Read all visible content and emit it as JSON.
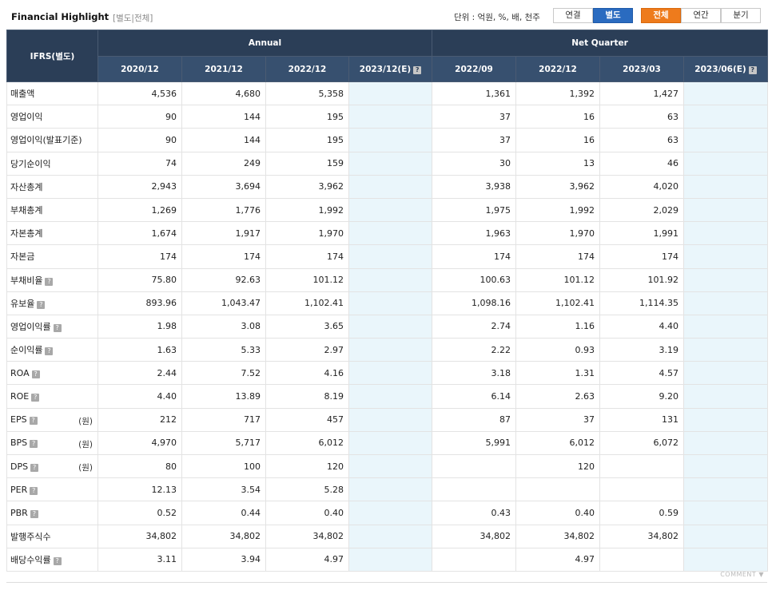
{
  "header": {
    "title": "Financial Highlight",
    "subtitle": "[별도|전체]",
    "unit": "단위 : 억원, %, 배, 천주",
    "buttons": {
      "consolidated": "연결",
      "separate": "별도",
      "all": "전체",
      "annual": "연간",
      "quarter": "분기"
    }
  },
  "table": {
    "corner_label": "IFRS(별도)",
    "groups": [
      "Annual",
      "Net Quarter"
    ],
    "columns": [
      "2020/12",
      "2021/12",
      "2022/12",
      "2023/12(E)",
      "2022/09",
      "2022/12",
      "2023/03",
      "2023/06(E)"
    ],
    "rows": [
      {
        "label": "매출액",
        "help": false,
        "unit": "",
        "values": [
          "4,536",
          "4,680",
          "5,358",
          "",
          "1,361",
          "1,392",
          "1,427",
          ""
        ]
      },
      {
        "label": "영업이익",
        "help": false,
        "unit": "",
        "values": [
          "90",
          "144",
          "195",
          "",
          "37",
          "16",
          "63",
          ""
        ]
      },
      {
        "label": "영업이익(발표기준)",
        "help": false,
        "unit": "",
        "values": [
          "90",
          "144",
          "195",
          "",
          "37",
          "16",
          "63",
          ""
        ]
      },
      {
        "label": "당기순이익",
        "help": false,
        "unit": "",
        "values": [
          "74",
          "249",
          "159",
          "",
          "30",
          "13",
          "46",
          ""
        ]
      },
      {
        "label": "자산총계",
        "help": false,
        "unit": "",
        "values": [
          "2,943",
          "3,694",
          "3,962",
          "",
          "3,938",
          "3,962",
          "4,020",
          ""
        ]
      },
      {
        "label": "부채총계",
        "help": false,
        "unit": "",
        "values": [
          "1,269",
          "1,776",
          "1,992",
          "",
          "1,975",
          "1,992",
          "2,029",
          ""
        ]
      },
      {
        "label": "자본총계",
        "help": false,
        "unit": "",
        "values": [
          "1,674",
          "1,917",
          "1,970",
          "",
          "1,963",
          "1,970",
          "1,991",
          ""
        ]
      },
      {
        "label": "자본금",
        "help": false,
        "unit": "",
        "values": [
          "174",
          "174",
          "174",
          "",
          "174",
          "174",
          "174",
          ""
        ]
      },
      {
        "label": "부채비율",
        "help": true,
        "unit": "",
        "values": [
          "75.80",
          "92.63",
          "101.12",
          "",
          "100.63",
          "101.12",
          "101.92",
          ""
        ]
      },
      {
        "label": "유보율",
        "help": true,
        "unit": "",
        "values": [
          "893.96",
          "1,043.47",
          "1,102.41",
          "",
          "1,098.16",
          "1,102.41",
          "1,114.35",
          ""
        ]
      },
      {
        "label": "영업이익률",
        "help": true,
        "unit": "",
        "values": [
          "1.98",
          "3.08",
          "3.65",
          "",
          "2.74",
          "1.16",
          "4.40",
          ""
        ]
      },
      {
        "label": "순이익률",
        "help": true,
        "unit": "",
        "values": [
          "1.63",
          "5.33",
          "2.97",
          "",
          "2.22",
          "0.93",
          "3.19",
          ""
        ]
      },
      {
        "label": "ROA",
        "help": true,
        "unit": "",
        "values": [
          "2.44",
          "7.52",
          "4.16",
          "",
          "3.18",
          "1.31",
          "4.57",
          ""
        ]
      },
      {
        "label": "ROE",
        "help": true,
        "unit": "",
        "values": [
          "4.40",
          "13.89",
          "8.19",
          "",
          "6.14",
          "2.63",
          "9.20",
          ""
        ]
      },
      {
        "label": "EPS",
        "help": true,
        "unit": "(원)",
        "values": [
          "212",
          "717",
          "457",
          "",
          "87",
          "37",
          "131",
          ""
        ]
      },
      {
        "label": "BPS",
        "help": true,
        "unit": "(원)",
        "values": [
          "4,970",
          "5,717",
          "6,012",
          "",
          "5,991",
          "6,012",
          "6,072",
          ""
        ]
      },
      {
        "label": "DPS",
        "help": true,
        "unit": "(원)",
        "values": [
          "80",
          "100",
          "120",
          "",
          "",
          "120",
          "",
          ""
        ]
      },
      {
        "label": "PER",
        "help": true,
        "unit": "",
        "values": [
          "12.13",
          "3.54",
          "5.28",
          "",
          "",
          "",
          "",
          ""
        ]
      },
      {
        "label": "PBR",
        "help": true,
        "unit": "",
        "values": [
          "0.52",
          "0.44",
          "0.40",
          "",
          "0.43",
          "0.40",
          "0.59",
          ""
        ]
      },
      {
        "label": "발행주식수",
        "help": false,
        "unit": "",
        "values": [
          "34,802",
          "34,802",
          "34,802",
          "",
          "34,802",
          "34,802",
          "34,802",
          ""
        ]
      },
      {
        "label": "배당수익률",
        "help": true,
        "unit": "",
        "values": [
          "3.11",
          "3.94",
          "4.97",
          "",
          "",
          "4.97",
          "",
          ""
        ]
      }
    ]
  },
  "footer": {
    "comment": "COMMENT ▼"
  },
  "colors": {
    "header_bg": "#2b3e57",
    "estimate_bg": "#eaf6fb",
    "blue_button": "#2a6bc0",
    "orange_button": "#ee7b1c"
  }
}
